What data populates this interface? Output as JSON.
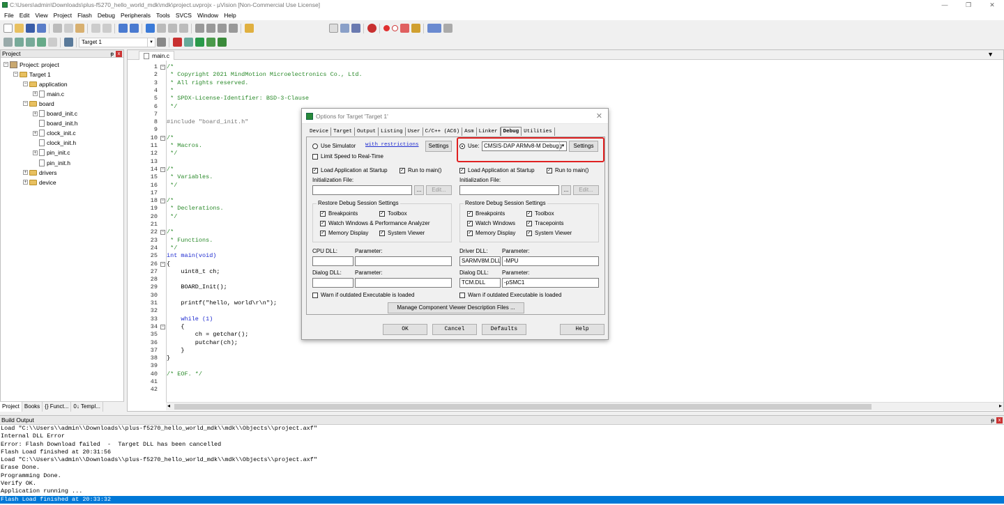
{
  "window": {
    "title": "C:\\Users\\admin\\Downloads\\plus-f5270_hello_world_mdk\\mdk\\project.uvprojx - µVision  [Non-Commercial Use License]",
    "minimize": "—",
    "maximize": "❐",
    "close": "✕"
  },
  "menu": [
    "File",
    "Edit",
    "View",
    "Project",
    "Flash",
    "Debug",
    "Peripherals",
    "Tools",
    "SVCS",
    "Window",
    "Help"
  ],
  "toolbar": {
    "target_select": "Target 1"
  },
  "project_panel": {
    "title": "Project",
    "pin": "ᵽ",
    "close": "x",
    "tree": [
      {
        "label": "Project: project",
        "level": 0,
        "kind": "project",
        "toggle": "−"
      },
      {
        "label": "Target 1",
        "level": 1,
        "kind": "folder",
        "toggle": "−"
      },
      {
        "label": "application",
        "level": 2,
        "kind": "folder",
        "toggle": "−"
      },
      {
        "label": "main.c",
        "level": 3,
        "kind": "file",
        "toggle": "+"
      },
      {
        "label": "board",
        "level": 2,
        "kind": "folder",
        "toggle": "−"
      },
      {
        "label": "board_init.c",
        "level": 3,
        "kind": "file",
        "toggle": "+"
      },
      {
        "label": "board_init.h",
        "level": 3,
        "kind": "file",
        "toggle": ""
      },
      {
        "label": "clock_init.c",
        "level": 3,
        "kind": "file",
        "toggle": "+"
      },
      {
        "label": "clock_init.h",
        "level": 3,
        "kind": "file",
        "toggle": ""
      },
      {
        "label": "pin_init.c",
        "level": 3,
        "kind": "file",
        "toggle": "+"
      },
      {
        "label": "pin_init.h",
        "level": 3,
        "kind": "file",
        "toggle": ""
      },
      {
        "label": "drivers",
        "level": 2,
        "kind": "folder",
        "toggle": "+"
      },
      {
        "label": "device",
        "level": 2,
        "kind": "folder",
        "toggle": "+"
      }
    ],
    "tabs": [
      "Project",
      "Books",
      "{} Funct...",
      "0↓ Templ..."
    ]
  },
  "editor": {
    "tab": "main.c",
    "lines": [
      "/*",
      " * Copyright 2021 MindMotion Microelectronics Co., Ltd.",
      " * All rights reserved.",
      " *",
      " * SPDX-License-Identifier: BSD-3-Clause",
      " */",
      "",
      "#include \"board_init.h\"",
      "",
      "/*",
      " * Macros.",
      " */",
      "",
      "/*",
      " * Variables.",
      " */",
      "",
      "/*",
      " * Declerations.",
      " */",
      "",
      "/*",
      " * Functions.",
      " */",
      "int main(void)",
      "{",
      "    uint8_t ch;",
      "",
      "    BOARD_Init();",
      "",
      "    printf(\"hello, world\\r\\n\");",
      "",
      "    while (1)",
      "    {",
      "        ch = getchar();",
      "        putchar(ch);",
      "    }",
      "}",
      "",
      "/* EOF. */",
      "",
      ""
    ]
  },
  "build_output": {
    "title": "Build Output",
    "lines": [
      "Load \"C:\\\\Users\\\\admin\\\\Downloads\\\\plus-f5270_hello_world_mdk\\\\mdk\\\\Objects\\\\project.axf\"",
      "Internal DLL Error",
      "Error: Flash Download failed  -  Target DLL has been cancelled",
      "Flash Load finished at 20:31:56",
      "Load \"C:\\\\Users\\\\admin\\\\Downloads\\\\plus-f5270_hello_world_mdk\\\\mdk\\\\Objects\\\\project.axf\"",
      "Erase Done.",
      "Programming Done.",
      "Verify OK.",
      "Application running ...",
      "Flash Load finished at 20:33:32"
    ]
  },
  "dialog": {
    "title": "Options for Target 'Target 1'",
    "close": "✕",
    "tabs": [
      "Device",
      "Target",
      "Output",
      "Listing",
      "User",
      "C/C++ (AC6)",
      "Asm",
      "Linker",
      "Debug",
      "Utilities"
    ],
    "active_tab": "Debug",
    "left": {
      "use_simulator": "Use Simulator",
      "with_restrictions": "with restrictions",
      "settings": "Settings",
      "limit_speed": "Limit Speed to Real-Time",
      "load_app": "Load Application at Startup",
      "run_to_main": "Run to main()",
      "init_file_label": "Initialization File:",
      "browse": "...",
      "edit": "Edit...",
      "restore_group": "Restore Debug Session Settings",
      "breakpoints": "Breakpoints",
      "toolbox": "Toolbox",
      "watch_windows": "Watch Windows & Performance Analyzer",
      "memory_display": "Memory Display",
      "system_viewer": "System Viewer",
      "cpu_dll": "CPU DLL:",
      "cpu_param": "Parameter:",
      "cpu_dll_value": "",
      "cpu_param_value": "",
      "dialog_dll": "Dialog DLL:",
      "dialog_param": "Parameter:",
      "dialog_dll_value": "",
      "dialog_param_value": "",
      "warn": "Warn if outdated Executable is loaded"
    },
    "right": {
      "use": "Use:",
      "driver": "CMSIS-DAP ARMv8-M Debugg",
      "settings": "Settings",
      "load_app": "Load Application at Startup",
      "run_to_main": "Run to main()",
      "init_file_label": "Initialization File:",
      "browse": "...",
      "edit": "Edit...",
      "restore_group": "Restore Debug Session Settings",
      "breakpoints": "Breakpoints",
      "toolbox": "Toolbox",
      "watch_windows": "Watch Windows",
      "tracepoints": "Tracepoints",
      "memory_display": "Memory Display",
      "system_viewer": "System Viewer",
      "driver_dll": "Driver DLL:",
      "driver_param": "Parameter:",
      "driver_dll_value": "SARMV8M.DLL",
      "driver_param_value": "-MPU",
      "dialog_dll": "Dialog DLL:",
      "dialog_param": "Parameter:",
      "dialog_dll_value": "TCM.DLL",
      "dialog_param_value": "-pSMC1",
      "warn": "Warn if outdated Executable is loaded"
    },
    "manage_btn": "Manage Component Viewer Description Files ...",
    "buttons": {
      "ok": "OK",
      "cancel": "Cancel",
      "defaults": "Defaults",
      "help": "Help"
    }
  }
}
